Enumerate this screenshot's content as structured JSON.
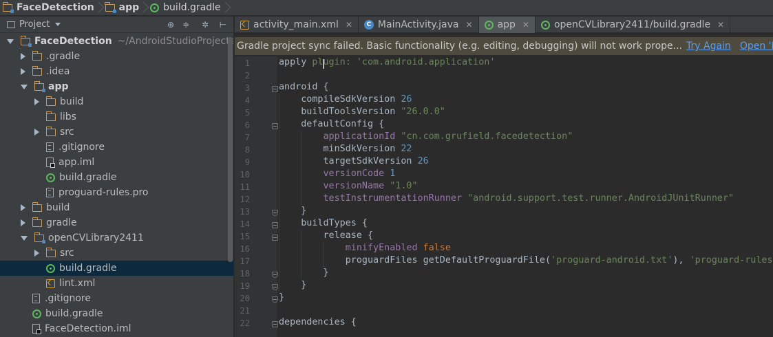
{
  "breadcrumb": {
    "project": "FaceDetection",
    "module": "app",
    "file": "build.gradle"
  },
  "panel": {
    "title": "Project",
    "tools": [
      "target-icon",
      "collapse-all-icon",
      "gear-icon",
      "hide-icon"
    ]
  },
  "tree": [
    {
      "label": "FaceDetection",
      "path": "~/AndroidStudioProjects/F",
      "icon": "folder-icon"
    },
    {
      "label": ".gradle",
      "icon": "folder-icon"
    },
    {
      "label": ".idea",
      "icon": "folder-icon"
    },
    {
      "label": "app",
      "icon": "module-folder-icon"
    },
    {
      "label": "build",
      "icon": "folder-icon"
    },
    {
      "label": "libs",
      "icon": "folder-icon"
    },
    {
      "label": "src",
      "icon": "folder-icon"
    },
    {
      "label": ".gitignore",
      "icon": "text-file-icon"
    },
    {
      "label": "app.iml",
      "icon": "iml-file-icon"
    },
    {
      "label": "build.gradle",
      "icon": "gradle-icon"
    },
    {
      "label": "proguard-rules.pro",
      "icon": "text-file-icon"
    },
    {
      "label": "build",
      "icon": "folder-icon"
    },
    {
      "label": "gradle",
      "icon": "folder-icon"
    },
    {
      "label": "openCVLibrary2411",
      "icon": "module-folder-icon"
    },
    {
      "label": "src",
      "icon": "folder-icon"
    },
    {
      "label": "build.gradle",
      "icon": "gradle-icon"
    },
    {
      "label": "lint.xml",
      "icon": "xml-file-icon"
    },
    {
      "label": ".gitignore",
      "icon": "text-file-icon"
    },
    {
      "label": "build.gradle",
      "icon": "gradle-icon"
    },
    {
      "label": "FaceDetection.iml",
      "icon": "iml-file-icon"
    }
  ],
  "tabs": [
    {
      "label": "activity_main.xml",
      "icon": "xml-file-icon"
    },
    {
      "label": "MainActivity.java",
      "icon": "java-class-icon"
    },
    {
      "label": "app",
      "icon": "gradle-icon"
    },
    {
      "label": "openCVLibrary2411/build.gradle",
      "icon": "gradle-icon"
    }
  ],
  "banner": {
    "message": "Gradle project sync failed. Basic functionality (e.g. editing, debugging) will not work prope...",
    "link_retry": "Try Again",
    "link_open": "Open 'Mes"
  },
  "editor": {
    "line_numbers": [
      "1",
      "2",
      "3",
      "4",
      "5",
      "6",
      "7",
      "8",
      "9",
      "10",
      "11",
      "12",
      "13",
      "14",
      "15",
      "16",
      "17",
      "18",
      "19",
      "20",
      "21",
      "22"
    ],
    "code": {
      "apply": "apply",
      "plugin": "plugin:",
      "plugin_value": "'com.android.application'",
      "android": "android {",
      "compileSdkVersion": "compileSdkVersion",
      "compileSdkVersion_value": "26",
      "buildToolsVersion": "buildToolsVersion",
      "buildToolsVersion_value": "\"26.0.0\"",
      "defaultConfig": "defaultConfig {",
      "applicationId": "applicationId",
      "applicationId_value": "\"cn.com.grufield.facedetection\"",
      "minSdkVersion": "minSdkVersion",
      "minSdkVersion_value": "22",
      "targetSdkVersion": "targetSdkVersion",
      "targetSdkVersion_value": "26",
      "versionCode": "versionCode",
      "versionCode_value": "1",
      "versionName": "versionName",
      "versionName_value": "\"1.0\"",
      "testRunner": "testInstrumentationRunner",
      "testRunner_value": "\"android.support.test.runner.AndroidJUnitRunner\"",
      "close_brace": "}",
      "buildTypes": "buildTypes {",
      "release": "release {",
      "minifyEnabled": "minifyEnabled",
      "minifyEnabled_value": "false",
      "proguardFiles": "proguardFiles getDefaultProguardFile(",
      "proguard_arg1": "'proguard-android.txt'",
      "proguard_sep": "), ",
      "proguard_arg2": "'proguard-rules.",
      "dependencies": "dependencies {"
    }
  }
}
